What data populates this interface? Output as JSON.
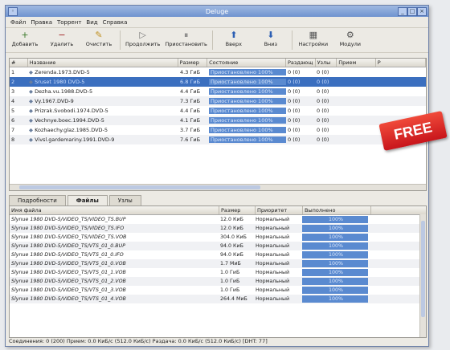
{
  "window": {
    "title": "Deluge"
  },
  "menu": [
    "Файл",
    "Правка",
    "Торрент",
    "Вид",
    "Справка"
  ],
  "toolbar": [
    {
      "label": "Добавить",
      "icon": "+"
    },
    {
      "label": "Удалить",
      "icon": "−"
    },
    {
      "label": "Очистить",
      "icon": "✎"
    },
    {
      "label": "Продолжить",
      "icon": "▷"
    },
    {
      "label": "Приостановить",
      "icon": "⏸"
    },
    {
      "label": "Вверх",
      "icon": "⬆"
    },
    {
      "label": "Вниз",
      "icon": "⬇"
    },
    {
      "label": "Настройки",
      "icon": "▦"
    },
    {
      "label": "Модули",
      "icon": "⚙"
    }
  ],
  "torrent_columns": [
    "#",
    "Название",
    "Размер",
    "Состояние",
    "Раздающ",
    "Узлы",
    "Прием",
    "Р"
  ],
  "torrents": [
    {
      "num": "1",
      "name": "Zerenda.1973.DVD-5",
      "size": "4.3 ГиБ",
      "state": "Приостановлено 100%",
      "seeders": "0 (0)",
      "peers": "0 (0)"
    },
    {
      "num": "2",
      "name": "Sruset 1980 DVD-5",
      "size": "6.8 ГиБ",
      "state": "Приостановлено 100%",
      "seeders": "0 (0)",
      "peers": "0 (0)"
    },
    {
      "num": "3",
      "name": "Dezha.vu.1988.DVD-5",
      "size": "4.4 ГиБ",
      "state": "Приостановлено 100%",
      "seeders": "0 (0)",
      "peers": "0 (0)"
    },
    {
      "num": "4",
      "name": "Vy.1967.DVD-9",
      "size": "7.3 ГиБ",
      "state": "Приостановлено 100%",
      "seeders": "0 (0)",
      "peers": "0 (0)"
    },
    {
      "num": "5",
      "name": "Prizrak.Svobodi.1974.DVD-5",
      "size": "4.4 ГиБ",
      "state": "Приостановлено 100%",
      "seeders": "0 (0)",
      "peers": "0 (0)"
    },
    {
      "num": "6",
      "name": "Vechnye.boec.1994.DVD-5",
      "size": "4.1 ГиБ",
      "state": "Приостановлено 100%",
      "seeders": "0 (0)",
      "peers": "0 (0)"
    },
    {
      "num": "7",
      "name": "Kozhaechy.glaz.1985.DVD-5",
      "size": "3.7 ГиБ",
      "state": "Приостановлено 100%",
      "seeders": "0 (0)",
      "peers": "0 (0)"
    },
    {
      "num": "8",
      "name": "Vivsl.gardemariny.1991.DVD-9",
      "size": "7.6 ГиБ",
      "state": "Приостановлено 100%",
      "seeders": "0 (0)",
      "peers": "0 (0)"
    }
  ],
  "tabs": [
    "Подробности",
    "Файлы",
    "Узлы"
  ],
  "file_columns": [
    "Имя файла",
    "Размер",
    "Приоритет",
    "Выполнено"
  ],
  "files": [
    {
      "name": "Slynue 1980 DVD-5/VIDEO_TS/VIDEO_TS.BUP",
      "size": "12.0 КиБ",
      "priority": "Нормальный",
      "done": "100%"
    },
    {
      "name": "Slynue 1980 DVD-5/VIDEO_TS/VIDEO_TS.IFO",
      "size": "12.0 КиБ",
      "priority": "Нормальный",
      "done": "100%"
    },
    {
      "name": "Slynue 1980 DVD-5/VIDEO_TS/VIDEO_TS.VOB",
      "size": "304.0 КиБ",
      "priority": "Нормальный",
      "done": "100%"
    },
    {
      "name": "Slynue 1980 DVD-5/VIDEO_TS/VTS_01_0.BUP",
      "size": "94.0 КиБ",
      "priority": "Нормальный",
      "done": "100%"
    },
    {
      "name": "Slynue 1980 DVD-5/VIDEO_TS/VTS_01_0.IFO",
      "size": "94.0 КиБ",
      "priority": "Нормальный",
      "done": "100%"
    },
    {
      "name": "Slynue 1980 DVD-5/VIDEO_TS/VTS_01_0.VOB",
      "size": "1.7 МиБ",
      "priority": "Нормальный",
      "done": "100%"
    },
    {
      "name": "Slynue 1980 DVD-5/VIDEO_TS/VTS_01_1.VOB",
      "size": "1.0 ГиБ",
      "priority": "Нормальный",
      "done": "100%"
    },
    {
      "name": "Slynue 1980 DVD-5/VIDEO_TS/VTS_01_2.VOB",
      "size": "1.0 ГиБ",
      "priority": "Нормальный",
      "done": "100%"
    },
    {
      "name": "Slynue 1980 DVD-5/VIDEO_TS/VTS_01_3.VOB",
      "size": "1.0 ГиБ",
      "priority": "Нормальный",
      "done": "100%"
    },
    {
      "name": "Slynue 1980 DVD-5/VIDEO_TS/VTS_01_4.VOB",
      "size": "264.4 МиБ",
      "priority": "Нормальный",
      "done": "100%"
    }
  ],
  "status": "Соединения: 0 (200)  Прием: 0.0 КиБ/с (512.0 КиБ/с)  Раздача: 0.0 КиБ/с (512.0 КиБ/с)  [DHT: 77]",
  "badge": {
    "text": "FREE"
  }
}
